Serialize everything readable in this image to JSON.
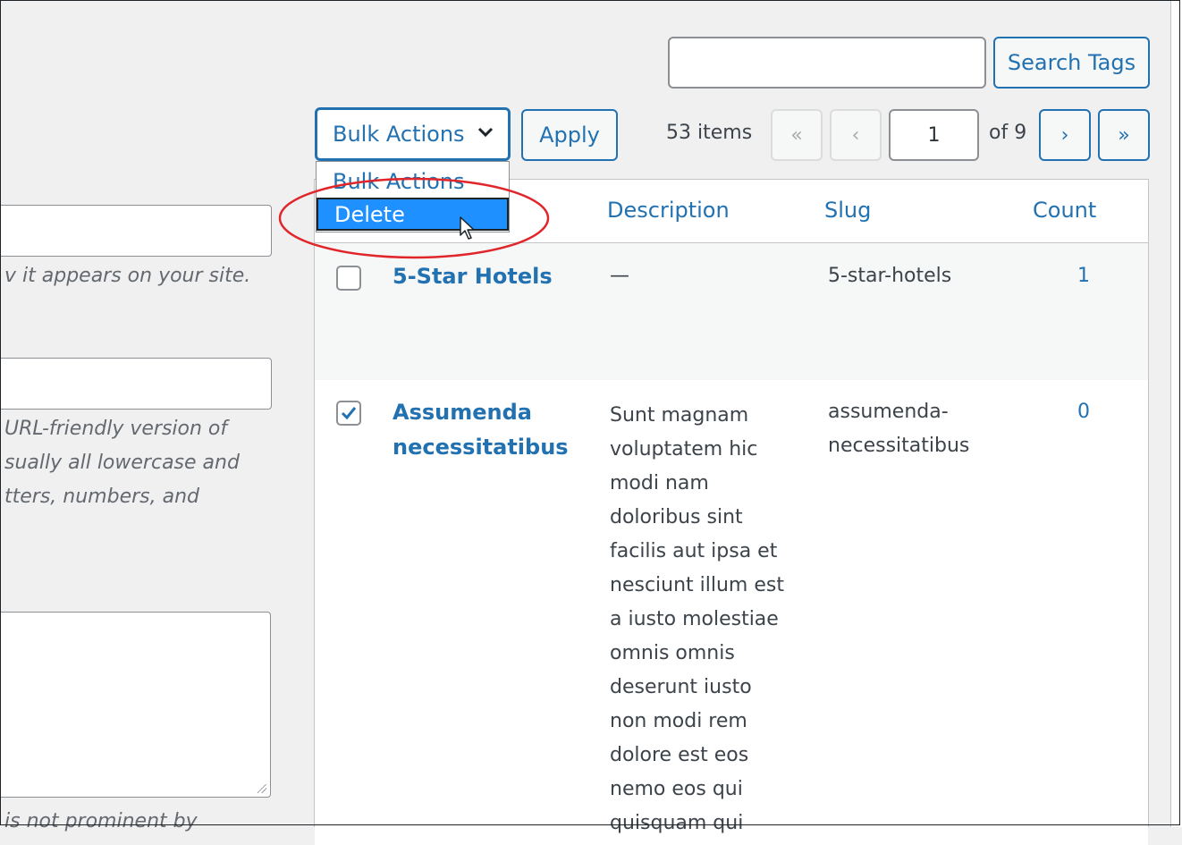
{
  "search": {
    "button_label": "Search Tags",
    "value": ""
  },
  "bulk": {
    "selected": "Bulk Actions",
    "apply_label": "Apply",
    "options": [
      "Bulk Actions",
      "Delete"
    ]
  },
  "pagination": {
    "items_label": "53 items",
    "first": "«",
    "prev": "‹",
    "current_page": "1",
    "of_label": "of 9",
    "next": "›",
    "last": "»"
  },
  "columns": {
    "description": "Description",
    "slug": "Slug",
    "count": "Count"
  },
  "rows": [
    {
      "name": "5-Star Hotels",
      "description": "—",
      "slug": "5-star-hotels",
      "count": "1",
      "checked": false
    },
    {
      "name": "Assumenda\nnecessitatibus",
      "description": "Sunt magnam\nvoluptatem hic\nmodi nam\ndoloribus sint\nfacilis aut ipsa et\nnesciunt illum est\na iusto molestiae\nomnis omnis\ndeserunt iusto\nnon modi rem\ndolore est eos\nnemo eos qui\nquisquam qui",
      "slug": "assumenda-\nnecessitatibus",
      "count": "0",
      "checked": true
    }
  ],
  "left_form": {
    "name_hint": "v it appears on your site.",
    "slug_hint_1": " URL-friendly version of",
    "slug_hint_2": "sually all lowercase and",
    "slug_hint_3": "tters, numbers, and",
    "desc_hint": "is not prominent by"
  },
  "colors": {
    "accent": "#2271b1",
    "highlight": "#1e90ff",
    "annotation": "#e0262b"
  },
  "icons": [
    "chevron-down-icon",
    "checkmark-icon",
    "mouse-cursor-icon"
  ]
}
